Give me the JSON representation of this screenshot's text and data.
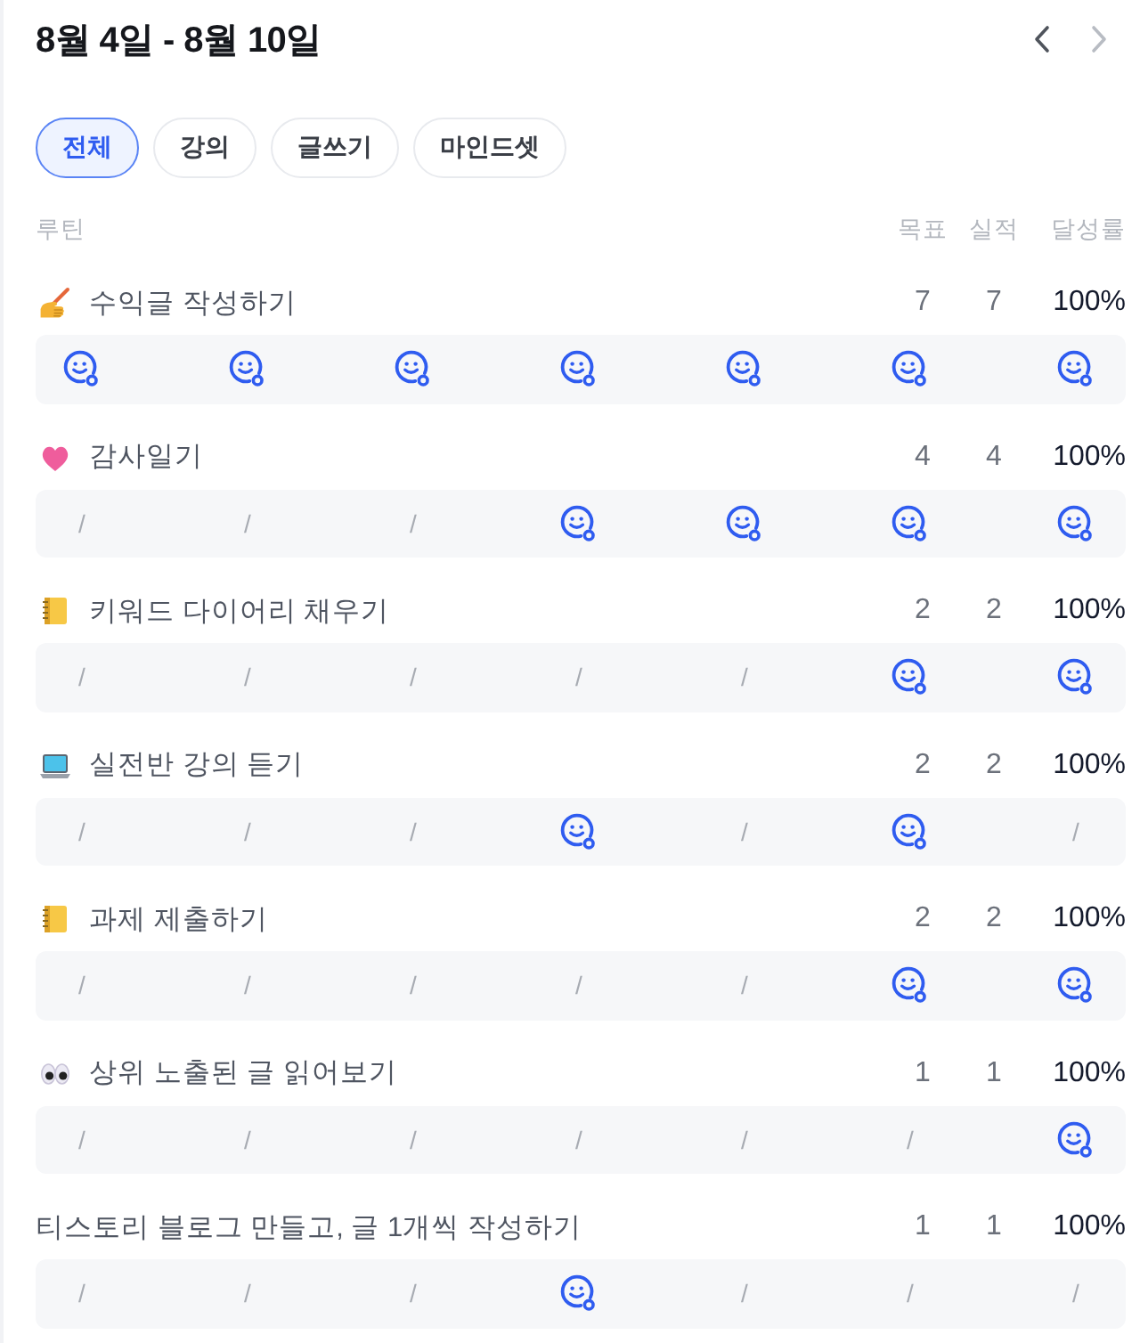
{
  "header": {
    "title": "8월 4일 - 8월 10일",
    "prev_button": {
      "disabled": false
    },
    "next_button": {
      "disabled": true
    }
  },
  "tabs": [
    {
      "label": "전체",
      "selected": true
    },
    {
      "label": "강의",
      "selected": false
    },
    {
      "label": "글쓰기",
      "selected": false
    },
    {
      "label": "마인드셋",
      "selected": false
    }
  ],
  "columns": {
    "routine": "루틴",
    "goal": "목표",
    "actual": "실적",
    "rate": "달성률"
  },
  "routines": [
    {
      "kind": "writing",
      "name": "수익글 작성하기",
      "goal": "7",
      "actual": "7",
      "rate": "100%",
      "days": [
        {
          "done": true
        },
        {
          "done": true
        },
        {
          "done": true
        },
        {
          "done": true
        },
        {
          "done": true
        },
        {
          "done": true
        },
        {
          "done": true
        }
      ]
    },
    {
      "kind": "heart",
      "name": "감사일기",
      "goal": "4",
      "actual": "4",
      "rate": "100%",
      "days": [
        {
          "done": false,
          "text": "/"
        },
        {
          "done": false,
          "text": "/"
        },
        {
          "done": false,
          "text": "/"
        },
        {
          "done": true
        },
        {
          "done": true
        },
        {
          "done": true
        },
        {
          "done": true
        }
      ]
    },
    {
      "kind": "notebook",
      "name": "키워드 다이어리 채우기",
      "goal": "2",
      "actual": "2",
      "rate": "100%",
      "days": [
        {
          "done": false,
          "text": "/"
        },
        {
          "done": false,
          "text": "/"
        },
        {
          "done": false,
          "text": "/"
        },
        {
          "done": false,
          "text": "/"
        },
        {
          "done": false,
          "text": "/"
        },
        {
          "done": true
        },
        {
          "done": true
        }
      ]
    },
    {
      "kind": "laptop",
      "name": "실전반 강의 듣기",
      "goal": "2",
      "actual": "2",
      "rate": "100%",
      "days": [
        {
          "done": false,
          "text": "/"
        },
        {
          "done": false,
          "text": "/"
        },
        {
          "done": false,
          "text": "/"
        },
        {
          "done": true
        },
        {
          "done": false,
          "text": "/"
        },
        {
          "done": true
        },
        {
          "done": false,
          "text": "/"
        }
      ]
    },
    {
      "kind": "notebook",
      "name": "과제 제출하기",
      "goal": "2",
      "actual": "2",
      "rate": "100%",
      "days": [
        {
          "done": false,
          "text": "/"
        },
        {
          "done": false,
          "text": "/"
        },
        {
          "done": false,
          "text": "/"
        },
        {
          "done": false,
          "text": "/"
        },
        {
          "done": false,
          "text": "/"
        },
        {
          "done": true
        },
        {
          "done": true
        }
      ]
    },
    {
      "kind": "eyes",
      "name": "상위 노출된 글 읽어보기",
      "goal": "1",
      "actual": "1",
      "rate": "100%",
      "days": [
        {
          "done": false,
          "text": "/"
        },
        {
          "done": false,
          "text": "/"
        },
        {
          "done": false,
          "text": "/"
        },
        {
          "done": false,
          "text": "/"
        },
        {
          "done": false,
          "text": "/"
        },
        {
          "done": false,
          "text": "/"
        },
        {
          "done": true
        }
      ]
    },
    {
      "kind": "plain",
      "name": "티스토리 블로그 만들고, 글 1개씩 작성하기",
      "goal": "1",
      "actual": "1",
      "rate": "100%",
      "days": [
        {
          "done": false,
          "text": "/"
        },
        {
          "done": false,
          "text": "/"
        },
        {
          "done": false,
          "text": "/"
        },
        {
          "done": true
        },
        {
          "done": false,
          "text": "/"
        },
        {
          "done": false,
          "text": "/"
        },
        {
          "done": false,
          "text": "/"
        }
      ]
    }
  ]
}
